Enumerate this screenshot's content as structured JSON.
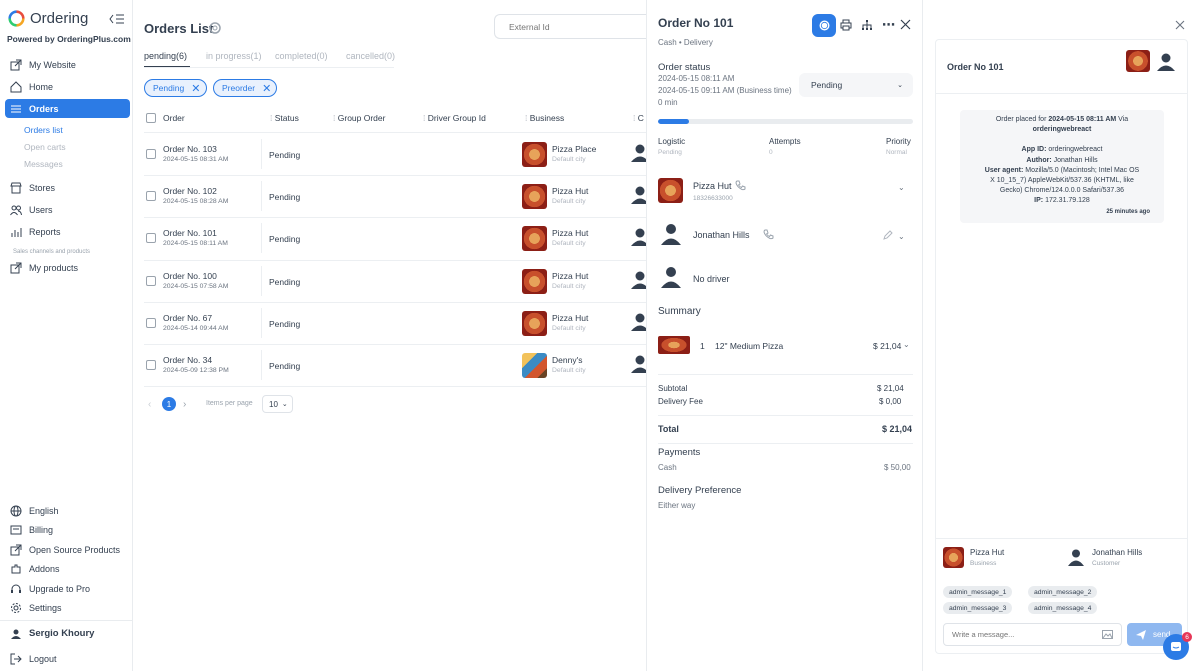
{
  "brand": {
    "name": "Ordering",
    "powered_by": "Powered by OrderingPlus.com"
  },
  "sidebar": {
    "items": [
      {
        "label": "My Website"
      },
      {
        "label": "Home"
      },
      {
        "label": "Orders"
      },
      {
        "label": "Stores"
      },
      {
        "label": "Users"
      },
      {
        "label": "Reports"
      },
      {
        "label": "My products"
      }
    ],
    "orders_sub": [
      "Orders list",
      "Open carts",
      "Messages"
    ],
    "section_label": "Sales channels and products",
    "bottom": [
      {
        "label": "English"
      },
      {
        "label": "Billing"
      },
      {
        "label": "Open Source Products"
      },
      {
        "label": "Addons"
      },
      {
        "label": "Upgrade to Pro"
      },
      {
        "label": "Settings"
      }
    ],
    "user_name": "Sergio Khoury",
    "logout": "Logout"
  },
  "orders": {
    "title": "Orders List",
    "search_placeholder": "External Id",
    "tabs": [
      "pending(6)",
      "in progress(1)",
      "completed(0)",
      "cancelled(0)"
    ],
    "filters": [
      "Pending",
      "Preorder"
    ],
    "columns": [
      "Order",
      "Status",
      "Group Order",
      "Driver Group Id",
      "Business",
      "C"
    ],
    "rows": [
      {
        "order": "Order No. 103",
        "date": "2024-05-15 08:31 AM",
        "status": "Pending",
        "business": "Pizza Place",
        "city": "Default city"
      },
      {
        "order": "Order No. 102",
        "date": "2024-05-15 08:28 AM",
        "status": "Pending",
        "business": "Pizza Hut",
        "city": "Default city"
      },
      {
        "order": "Order No. 101",
        "date": "2024-05-15 08:11 AM",
        "status": "Pending",
        "business": "Pizza Hut",
        "city": "Default city"
      },
      {
        "order": "Order No. 100",
        "date": "2024-05-15 07:58 AM",
        "status": "Pending",
        "business": "Pizza Hut",
        "city": "Default city"
      },
      {
        "order": "Order No. 67",
        "date": "2024-05-14 09:44 AM",
        "status": "Pending",
        "business": "Pizza Hut",
        "city": "Default city"
      },
      {
        "order": "Order No. 34",
        "date": "2024-05-09 12:38 PM",
        "status": "Pending",
        "business": "Denny's",
        "city": "Default city"
      }
    ],
    "pagination": {
      "page": "1",
      "items_per_page_label": "Items per page",
      "items_per_page": "10"
    }
  },
  "order_detail": {
    "title": "Order No 101",
    "subtitle": "Cash • Delivery",
    "status_heading": "Order status",
    "date1": "2024-05-15 08:11 AM",
    "date2": "2024-05-15 09:11 AM (Business time)",
    "minutes": "0 min",
    "status_select": "Pending",
    "progress": 0.12,
    "logistic_label": "Logistic",
    "logistic_value": "Pending",
    "attempts_label": "Attempts",
    "attempts_value": "0",
    "priority_label": "Priority",
    "priority_value": "Normal",
    "business_name": "Pizza Hut",
    "business_phone": "18326633000",
    "customer_name": "Jonathan Hills",
    "driver": "No driver",
    "summary_heading": "Summary",
    "item_qty": "1",
    "item_name": "12\" Medium Pizza",
    "item_price": "$ 21,04",
    "subtotal_label": "Subtotal",
    "subtotal": "$ 21,04",
    "delivery_fee_label": "Delivery Fee",
    "delivery_fee": "$ 0,00",
    "total_label": "Total",
    "total": "$ 21,04",
    "payments_heading": "Payments",
    "payment_method": "Cash",
    "payment_amount": "$ 50,00",
    "delivery_pref_heading": "Delivery Preference",
    "delivery_pref": "Either way"
  },
  "chat": {
    "title": "Order No 101",
    "msg_prefix": "Order placed for",
    "msg_date": "2024-05-15 08:11 AM",
    "msg_via": "Via",
    "msg_app": "orderingwebreact",
    "app_id_label": "App ID:",
    "app_id": "orderingwebreact",
    "author_label": "Author:",
    "author": "Jonathan Hills",
    "ua_label": "User agent:",
    "ua_line1": "Mozilla/5.0 (Macintosh; Intel Mac OS",
    "ua_line2": "X 10_15_7) AppleWebKit/537.36 (KHTML, like",
    "ua_line3": "Gecko) Chrome/124.0.0.0 Safari/537.36",
    "ip_label": "IP:",
    "ip": "172.31.79.128",
    "msg_time": "25 minutes ago",
    "business_name": "Pizza Hut",
    "business_role": "Business",
    "customer_name": "Jonathan Hills",
    "customer_role": "Customer",
    "quick_messages": [
      "admin_message_1",
      "admin_message_2",
      "admin_message_3",
      "admin_message_4"
    ],
    "input_placeholder": "Write a message...",
    "send_label": "send",
    "notification_count": "6"
  },
  "colors": {
    "accent": "#2c7be5",
    "text": "#344050",
    "muted": "#b0b6bf"
  }
}
